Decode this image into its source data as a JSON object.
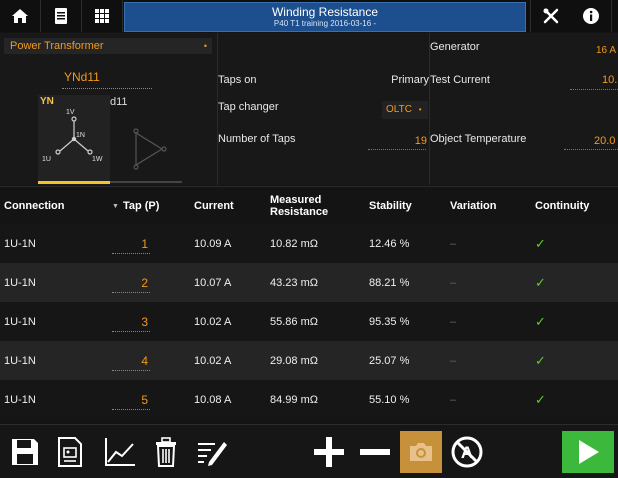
{
  "window": {
    "title": "Winding Resistance",
    "subtitle": "P40 T1 training 2016-03-16 -"
  },
  "toolbar_icons": [
    "home-icon",
    "document-icon",
    "grid-icon",
    "tools-icon",
    "info-icon"
  ],
  "config": {
    "transformer_type": "Power Transformer",
    "vector_group": "YNd11",
    "hv_winding": {
      "label": "YN",
      "phases": [
        "1V",
        "1N",
        "1U",
        "1W"
      ]
    },
    "lv_winding": {
      "label": "d11"
    },
    "taps_on_label": "Taps on",
    "taps_on_value": "Primary",
    "tap_changer_label": "Tap changer",
    "tap_changer_value": "OLTC",
    "number_of_taps_label": "Number of Taps",
    "number_of_taps_value": "19",
    "generator_label": "Generator",
    "generator_value": "16 A",
    "test_current_label": "Test Current",
    "test_current_value": "10.",
    "object_temperature_label": "Object Temperature",
    "object_temperature_value": "20.0"
  },
  "table": {
    "headers": {
      "connection": "Connection",
      "tap": "Tap (P)",
      "current": "Current",
      "measured_resistance_line1": "Measured",
      "measured_resistance_line2": "Resistance",
      "stability": "Stability",
      "variation": "Variation",
      "continuity": "Continuity"
    },
    "rows": [
      {
        "connection": "1U-1N",
        "tap": "1",
        "current": "10.09 A",
        "resistance": "10.82 mΩ",
        "stability": "12.46 %",
        "variation": "–",
        "continuity": "✓"
      },
      {
        "connection": "1U-1N",
        "tap": "2",
        "current": "10.07 A",
        "resistance": "43.23 mΩ",
        "stability": "88.21 %",
        "variation": "–",
        "continuity": "✓"
      },
      {
        "connection": "1U-1N",
        "tap": "3",
        "current": "10.02 A",
        "resistance": "55.86 mΩ",
        "stability": "95.35 %",
        "variation": "–",
        "continuity": "✓"
      },
      {
        "connection": "1U-1N",
        "tap": "4",
        "current": "10.02 A",
        "resistance": "29.08 mΩ",
        "stability": "25.07 %",
        "variation": "–",
        "continuity": "✓"
      },
      {
        "connection": "1U-1N",
        "tap": "5",
        "current": "10.08 A",
        "resistance": "84.99 mΩ",
        "stability": "55.10 %",
        "variation": "–",
        "continuity": "✓"
      }
    ]
  },
  "bottom_icons": [
    "save-icon",
    "report-icon",
    "chart-icon",
    "delete-icon",
    "edit-icon",
    "plus-icon",
    "minus-icon",
    "camera-icon",
    "no-auto-icon",
    "play-icon"
  ],
  "colors": {
    "accent": "#f39a1e",
    "title_blue": "#1d4f8e",
    "play_green": "#3cb93c",
    "check_green": "#5ccf2a",
    "winding_yellow": "#f3c428"
  }
}
